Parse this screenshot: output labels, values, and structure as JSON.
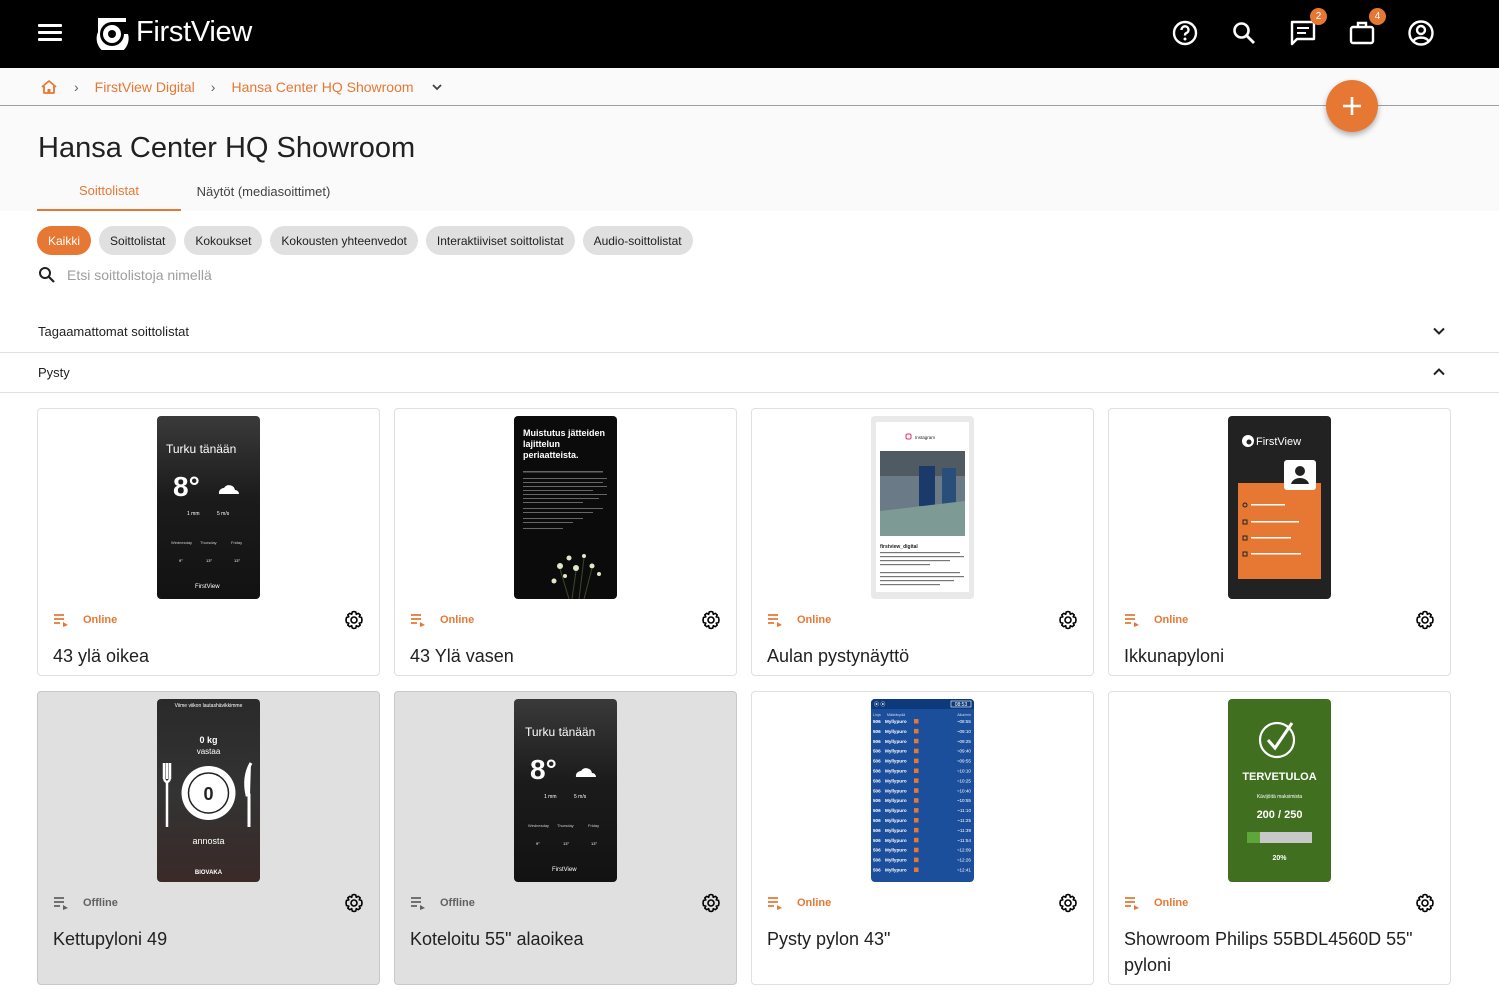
{
  "app": {
    "logo_text": "FirstView"
  },
  "topbar": {
    "messages_badge": "2",
    "briefcase_badge": "4"
  },
  "breadcrumb": {
    "level1": "FirstView Digital",
    "level2": "Hansa Center HQ Showroom"
  },
  "page": {
    "title": "Hansa Center HQ Showroom"
  },
  "tabs": [
    {
      "label": "Soittolistat"
    },
    {
      "label": "Näytöt (mediasoittimet)"
    }
  ],
  "chips": [
    {
      "label": "Kaikki"
    },
    {
      "label": "Soittolistat"
    },
    {
      "label": "Kokoukset"
    },
    {
      "label": "Kokousten yhteenvedot"
    },
    {
      "label": "Interaktiiviset soittolistat"
    },
    {
      "label": "Audio-soittolistat"
    }
  ],
  "search": {
    "placeholder": "Etsi soittolistoja nimellä"
  },
  "sections": [
    {
      "label": "Tagaamattomat soittolistat"
    },
    {
      "label": "Pysty"
    }
  ],
  "cards": [
    {
      "name": "43 ylä oikea",
      "status": "Online",
      "thumb": {
        "title": "Turku tänään",
        "temp": "8°",
        "rain": "1 mm",
        "wind": "5 m/s",
        "days": [
          "Wednesday",
          "Thursday",
          "Friday"
        ],
        "day_temps": [
          "9°",
          "13°",
          "13°"
        ],
        "brand": "FirstView"
      }
    },
    {
      "name": "43 Ylä vasen",
      "status": "Online",
      "thumb": {
        "title": "Muistutus jätteiden lajittelun periaatteista."
      }
    },
    {
      "name": "Aulan pystynäyttö",
      "status": "Online",
      "thumb": {
        "header": "Instagram",
        "account": "firstview_digital"
      }
    },
    {
      "name": "Ikkunapyloni",
      "status": "Online",
      "thumb": {
        "brand": "FirstView"
      }
    },
    {
      "name": "Kettupyloni 49",
      "status": "Offline",
      "thumb": {
        "header": "Viime viikon lautashävikkimme",
        "amount": "0 kg",
        "sub": "vastaa",
        "count": "0",
        "unit": "annosta",
        "brand": "BIOVAKA"
      }
    },
    {
      "name": "Koteloitu 55\" alaoikea",
      "status": "Offline",
      "thumb": {
        "title": "Turku tänään",
        "temp": "8°",
        "rain": "1 mm",
        "wind": "5 m/s",
        "days": [
          "Wednesday",
          "Thursday",
          "Friday"
        ],
        "day_temps": [
          "9°",
          "13°",
          "13°"
        ],
        "brand": "FirstView"
      }
    },
    {
      "name": "Pysty pylon 43\"",
      "status": "Online",
      "thumb": {
        "clock": "08:53",
        "col1": "Linja",
        "col2": "Määränpää",
        "col3": "Aika/min",
        "line": "506",
        "destination": "Myllypuro",
        "times": [
          "08:55",
          "09:10",
          "09:25",
          "09:40",
          "09:55",
          "10:10",
          "10:25",
          "10:40",
          "10:55",
          "11:10",
          "11:25",
          "11:39",
          "11:54",
          "12:09",
          "12:26",
          "12:41"
        ]
      }
    },
    {
      "name": "Showroom Philips 55BDL4560D 55\" pyloni",
      "status": "Online",
      "thumb": {
        "title": "TERVETULOA",
        "sub": "Kävijöitä maksimista",
        "count": "200 / 250",
        "percent": "20%",
        "fill": 0.2
      }
    }
  ],
  "colors": {
    "accent": "#e67834",
    "topbar": "#000000"
  }
}
